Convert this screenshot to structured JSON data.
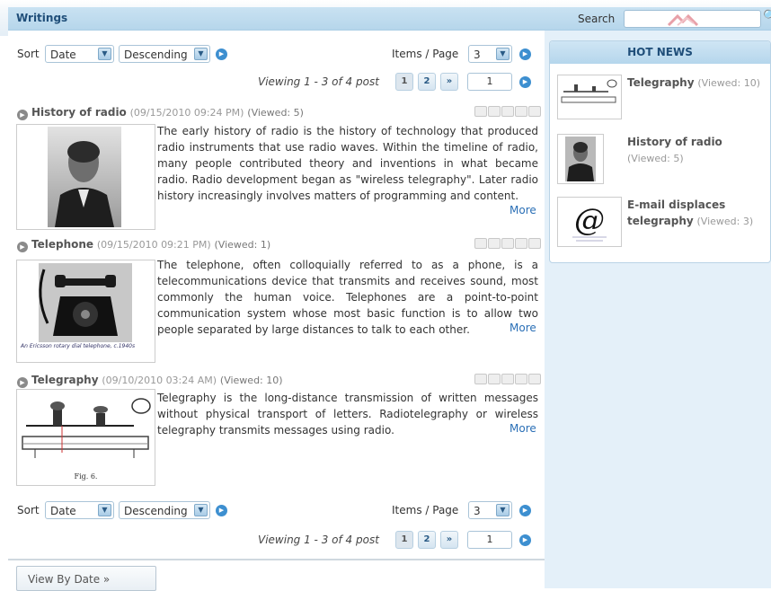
{
  "header": {
    "title": "Writings",
    "search_label": "Search",
    "search_value": ""
  },
  "controls": {
    "sort_label": "Sort",
    "sort_by": "Date",
    "sort_order": "Descending",
    "items_per_page_label": "Items / Page",
    "items_per_page": "3",
    "viewing_text": "Viewing 1 - 3 of 4 post",
    "pages": [
      "1",
      "2"
    ],
    "next_label": "»",
    "current_page_input": "1"
  },
  "posts": [
    {
      "title": "History of radio",
      "date": "(09/15/2010 09:24 PM)",
      "views": "(Viewed: 5)",
      "excerpt": "The early history of radio is the history of technology that produced radio instruments that use radio waves. Within the timeline of radio, many people contributed theory and inventions in what became radio. Radio development began as \"wireless telegraphy\". Later radio history increasingly involves matters of programming and content.",
      "more": "More",
      "rating": 0
    },
    {
      "title": "Telephone",
      "date": "(09/15/2010 09:21 PM)",
      "views": "(Viewed: 1)",
      "excerpt": "The telephone, often colloquially referred to as a phone, is a telecommunications device that transmits and receives sound, most commonly the human voice. Telephones are a point-to-point communication system whose most basic function is to allow two people separated by large distances to talk to each other.",
      "more": "More",
      "image_caption": "An Ericsson rotary dial telephone, c.1940s",
      "rating": 0
    },
    {
      "title": "Telegraphy",
      "date": "(09/10/2010 03:24 AM)",
      "views": "(Viewed: 10)",
      "excerpt": "Telegraphy is the long-distance transmission of written messages without physical transport of letters. Radiotelegraphy or wireless telegraphy transmits messages using radio.",
      "more": "More",
      "image_caption": "Fig. 6.",
      "rating": 0
    }
  ],
  "footer": {
    "view_by_date": "View By Date »"
  },
  "hot_news": {
    "header": "HOT NEWS",
    "items": [
      {
        "title": "Telegraphy",
        "views": "(Viewed: 10)"
      },
      {
        "title": "History of radio",
        "views": "(Viewed: 5)"
      },
      {
        "title": "E-mail displaces telegraphy",
        "views": "(Viewed: 3)"
      }
    ]
  },
  "colors": {
    "accent": "#3d8fd0",
    "title_blue": "#1f4e79",
    "link": "#2a6fb6",
    "sidebar_bg": "#e4f0f9"
  }
}
